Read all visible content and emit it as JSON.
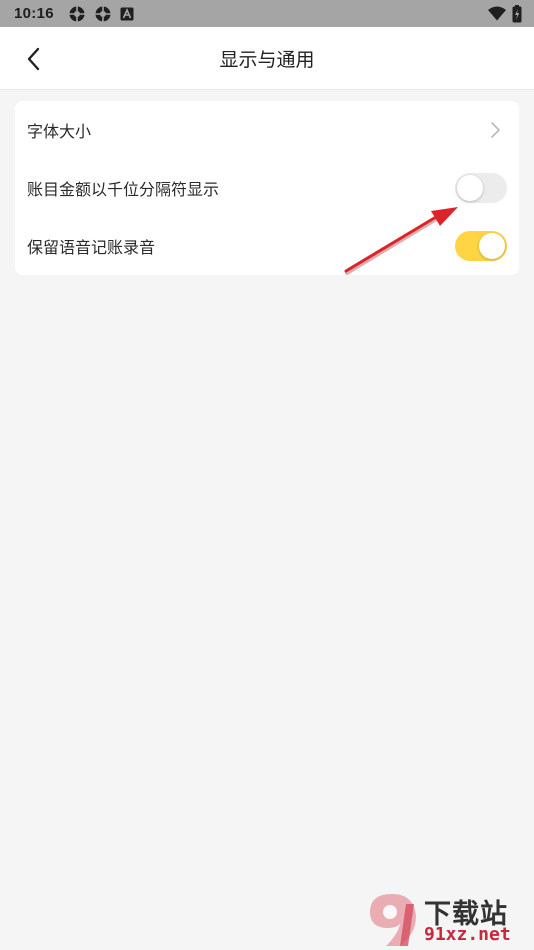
{
  "status_bar": {
    "time": "10:16",
    "left_icons": [
      "settings-gear-icon",
      "settings-gear-icon",
      "android-auto-icon"
    ],
    "right_icons": [
      "wifi-icon",
      "battery-charging-icon"
    ]
  },
  "header": {
    "title": "显示与通用",
    "back_icon": "chevron-left-icon"
  },
  "settings": {
    "font_size": {
      "label": "字体大小",
      "icon": "chevron-right-icon"
    },
    "thousand_separator": {
      "label": "账目金额以千位分隔符显示",
      "enabled": false
    },
    "keep_voice": {
      "label": "保留语音记账录音",
      "enabled": true
    }
  },
  "watermark": {
    "brand": "下载站",
    "domain": "91xz.net"
  },
  "colors": {
    "toggle_on": "#ffd545",
    "toggle_off": "#ececec",
    "annotation_arrow": "#d9242a",
    "status_bar": "#a5a5a5",
    "background": "#f5f5f5"
  }
}
